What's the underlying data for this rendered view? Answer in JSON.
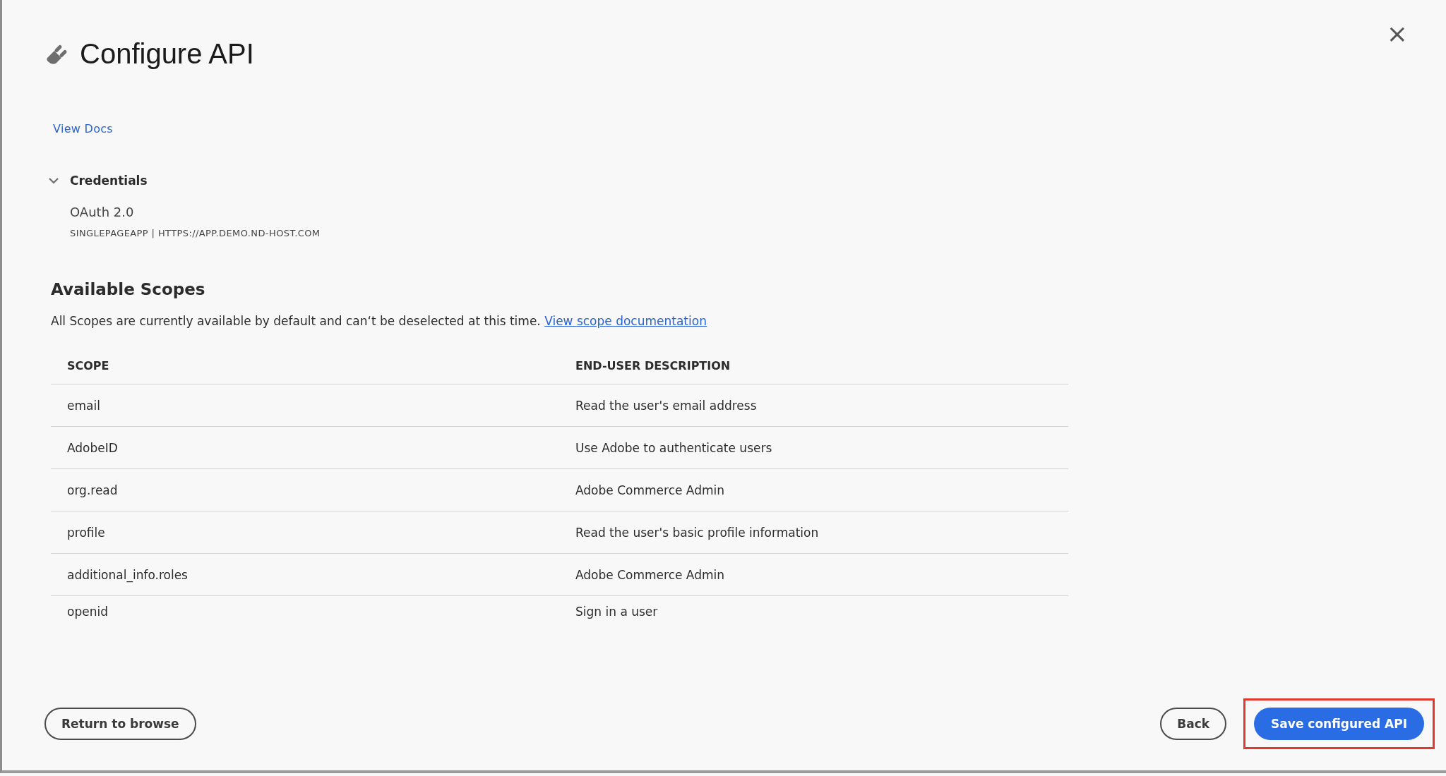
{
  "dialog": {
    "title": "Configure API",
    "close_label": "×"
  },
  "view_docs": "View Docs",
  "credentials": {
    "heading": "Credentials",
    "expanded": true,
    "type": "OAuth 2.0",
    "detail": "SINGLEPAGEAPP | HTTPS://APP.DEMO.ND-HOST.COM"
  },
  "scopes": {
    "heading": "Available Scopes",
    "description": "All Scopes are currently available by default and can‘t be deselected at this time.",
    "link": "View scope documentation",
    "table": {
      "columns": [
        "SCOPE",
        "END-USER DESCRIPTION"
      ],
      "rows": [
        {
          "scope": "email",
          "description": "Read the user's email address"
        },
        {
          "scope": "AdobeID",
          "description": "Use Adobe to authenticate users"
        },
        {
          "scope": "org.read",
          "description": "Adobe Commerce Admin"
        },
        {
          "scope": "profile",
          "description": "Read the user's basic profile information"
        },
        {
          "scope": "additional_info.roles",
          "description": "Adobe Commerce Admin"
        },
        {
          "scope": "openid",
          "description": "Sign in a user"
        }
      ]
    }
  },
  "footer": {
    "left_button": "Return to browse",
    "back_button": "Back",
    "primary_button": "Save configured API",
    "primary_highlighted": true
  }
}
